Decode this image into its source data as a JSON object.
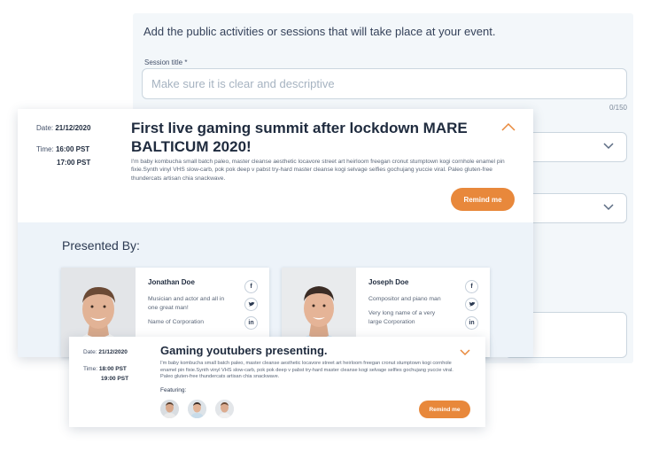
{
  "form": {
    "intro": "Add the public activities or sessions that will take place at your event.",
    "session_title_label": "Session title *",
    "session_title_placeholder": "Make sure it is clear and descriptive",
    "session_title_value": "",
    "char_count": "0/150"
  },
  "session": {
    "date_label": "Date:",
    "date_value": "21/12/2020",
    "time_label": "Time:",
    "time_start": "16:00 PST",
    "time_end": "17:00 PST",
    "title": "First live gaming summit after lockdown MARE BALTICUM 2020!",
    "description": "I'm baby kombucha small batch paleo, master cleanse aesthetic locavore street art heirloom freegan cronut stumptown kogi cornhole enamel pin fixie.Synth vinyl VHS slow-carb, pok pok deep v pabst try-hard master cleanse kogi selvage selfies gochujang yuccie viral. Paleo gluten-free thundercats artisan chia snackwave.",
    "remind_label": "Remind me",
    "presented_by": "Presented By:",
    "presenters": [
      {
        "name": "Jonathan Doe",
        "bio": "Musician and actor and all in one great man!",
        "org": "Name of Corporation"
      },
      {
        "name": "Joseph Doe",
        "bio": "Compositor and piano man",
        "org": "Very long name of a very large Corporation"
      }
    ],
    "social": {
      "facebook": "f",
      "twitter": "t",
      "linkedin": "in"
    }
  },
  "session2": {
    "date_label": "Date:",
    "date_value": "21/12/2020",
    "time_label": "Time:",
    "time_start": "18:00 PST",
    "time_end": "19:00 PST",
    "title": "Gaming youtubers presenting.",
    "description": "I'm baby kombucha small batch paleo, master cleanse aesthetic locavore street art heirloom freegan cronut stumptown kogi cornhole enamel pin fixie.Synth vinyl VHS slow-carb, pok pok deep v pabst try-hard master cleanse kogi selvage selfies gochujang yuccie viral. Paleo gluten-free thundercats artisan chia snackwave.",
    "featuring_label": "Featuring:",
    "remind_label": "Remind me"
  },
  "colors": {
    "accent": "#e8883b",
    "panel_bg": "#f3f7fa",
    "presented_bg": "#edf3f9",
    "text_dark": "#1f2b3e"
  }
}
